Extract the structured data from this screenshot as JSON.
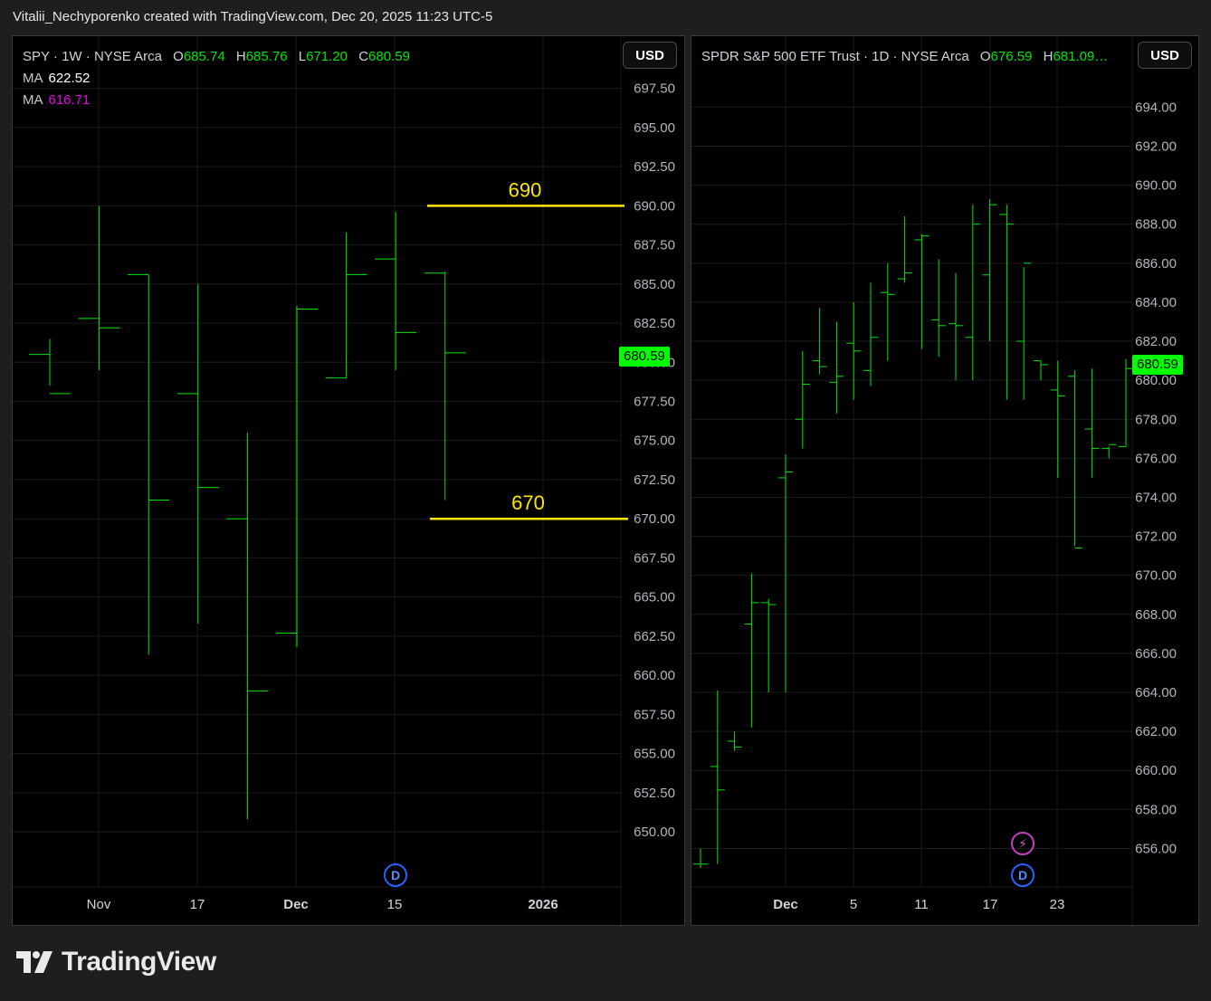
{
  "caption": "Vitalii_Nechyporenko created with TradingView.com, Dec 20, 2025 11:23 UTC-5",
  "brand": "TradingView",
  "colors": {
    "up": "#00e600",
    "price_tag": "#00ff00",
    "line": "#ffe600",
    "ma2": "#e600e6",
    "grid": "#1c1c1c"
  },
  "left": {
    "symbol": "SPY",
    "interval": "1W",
    "exchange": "NYSE Arca",
    "ohlc": {
      "O": "685.74",
      "H": "685.76",
      "L": "671.20",
      "C": "680.59"
    },
    "ma": [
      {
        "label": "MA",
        "value": "622.52"
      },
      {
        "label": "MA",
        "value": "616.71"
      }
    ],
    "currency": "USD",
    "last_price": "680.59",
    "badge": "D",
    "axis_labels": [
      "697.50",
      "695.00",
      "692.50",
      "690.00",
      "687.50",
      "685.00",
      "682.50",
      "680.00",
      "677.50",
      "675.00",
      "672.50",
      "670.00",
      "667.50",
      "665.00",
      "662.50",
      "660.00",
      "657.50",
      "655.00",
      "652.50",
      "650.00"
    ],
    "time_labels": [
      "Nov",
      "17",
      "Dec",
      "15",
      "2026"
    ]
  },
  "right": {
    "title": "SPDR S&P 500 ETF Trust",
    "interval": "1D",
    "exchange": "NYSE Arca",
    "ohlc": {
      "O": "676.59",
      "H": "681.09…"
    },
    "currency": "USD",
    "last_price": "680.59",
    "badge": "D",
    "axis_labels": [
      "694.00",
      "692.00",
      "690.00",
      "688.00",
      "686.00",
      "684.00",
      "682.00",
      "680.00",
      "678.00",
      "676.00",
      "674.00",
      "672.00",
      "670.00",
      "668.00",
      "666.00",
      "664.00",
      "662.00",
      "660.00",
      "658.00",
      "656.00"
    ],
    "time_labels": [
      "Dec",
      "5",
      "11",
      "17",
      "23"
    ]
  },
  "chart_data": [
    {
      "type": "ohlc",
      "symbol": "SPY",
      "interval": "1W",
      "bars": [
        {
          "o": 680.5,
          "h": 681.5,
          "l": 678.5,
          "c": 678.0
        },
        {
          "o": 682.8,
          "h": 690.0,
          "l": 679.5,
          "c": 682.2
        },
        {
          "o": 685.6,
          "h": 685.6,
          "l": 661.3,
          "c": 671.2
        },
        {
          "o": 678.0,
          "h": 685.0,
          "l": 663.3,
          "c": 672.0
        },
        {
          "o": 670.0,
          "h": 675.5,
          "l": 650.8,
          "c": 659.0
        },
        {
          "o": 662.7,
          "h": 683.6,
          "l": 661.8,
          "c": 683.4
        },
        {
          "o": 679.0,
          "h": 688.3,
          "l": 679.0,
          "c": 685.6
        },
        {
          "o": 686.6,
          "h": 689.6,
          "l": 679.5,
          "c": 681.9
        },
        {
          "o": 685.7,
          "h": 685.8,
          "l": 671.2,
          "c": 680.6
        }
      ],
      "ylim": [
        648.5,
        698
      ],
      "hlines": [
        {
          "value": 690,
          "label": "690"
        },
        {
          "value": 670,
          "label": "670"
        }
      ],
      "xticks": [
        "Nov",
        "17",
        "Dec",
        "15",
        "2026"
      ]
    },
    {
      "type": "ohlc",
      "symbol": "SPDR S&P 500 ETF Trust",
      "interval": "1D",
      "bars": [
        {
          "o": 655.2,
          "h": 656.0,
          "l": 655.0,
          "c": 655.2
        },
        {
          "o": 660.2,
          "h": 664.1,
          "l": 655.2,
          "c": 659.0
        },
        {
          "o": 661.5,
          "h": 662.0,
          "l": 661.0,
          "c": 661.2
        },
        {
          "o": 667.5,
          "h": 670.1,
          "l": 662.2,
          "c": 668.6
        },
        {
          "o": 668.6,
          "h": 668.8,
          "l": 664.0,
          "c": 668.5
        },
        {
          "o": 675.0,
          "h": 676.2,
          "l": 664.0,
          "c": 675.3
        },
        {
          "o": 678.0,
          "h": 681.5,
          "l": 676.5,
          "c": 679.8
        },
        {
          "o": 681.0,
          "h": 683.7,
          "l": 680.3,
          "c": 680.7
        },
        {
          "o": 679.9,
          "h": 683.0,
          "l": 678.3,
          "c": 680.2
        },
        {
          "o": 681.9,
          "h": 684.0,
          "l": 679.0,
          "c": 681.5
        },
        {
          "o": 680.5,
          "h": 685.0,
          "l": 679.7,
          "c": 682.2
        },
        {
          "o": 684.5,
          "h": 686.0,
          "l": 681.0,
          "c": 684.4
        },
        {
          "o": 685.2,
          "h": 688.4,
          "l": 685.0,
          "c": 685.5
        },
        {
          "o": 687.2,
          "h": 687.5,
          "l": 681.6,
          "c": 687.4
        },
        {
          "o": 683.1,
          "h": 686.2,
          "l": 681.2,
          "c": 682.8
        },
        {
          "o": 682.9,
          "h": 685.5,
          "l": 680.0,
          "c": 682.8
        },
        {
          "o": 682.2,
          "h": 689.0,
          "l": 680.0,
          "c": 688.0
        },
        {
          "o": 685.4,
          "h": 689.3,
          "l": 682.0,
          "c": 689.0
        },
        {
          "o": 688.5,
          "h": 689.0,
          "l": 679.0,
          "c": 688.0
        },
        {
          "o": 682.0,
          "h": 685.8,
          "l": 679.0,
          "c": 686.0
        },
        {
          "o": 681.0,
          "h": 681.0,
          "l": 680.0,
          "c": 680.8
        },
        {
          "o": 679.5,
          "h": 681.0,
          "l": 675.0,
          "c": 679.2
        },
        {
          "o": 680.2,
          "h": 680.5,
          "l": 671.5,
          "c": 671.4
        },
        {
          "o": 677.5,
          "h": 680.6,
          "l": 675.0,
          "c": 676.5
        },
        {
          "o": 676.5,
          "h": 676.6,
          "l": 676.0,
          "c": 676.7
        },
        {
          "o": 676.6,
          "h": 681.1,
          "l": 676.6,
          "c": 680.6
        }
      ],
      "ylim": [
        655,
        694.9
      ],
      "xticks": [
        "Dec",
        "5",
        "11",
        "17",
        "23"
      ]
    }
  ]
}
